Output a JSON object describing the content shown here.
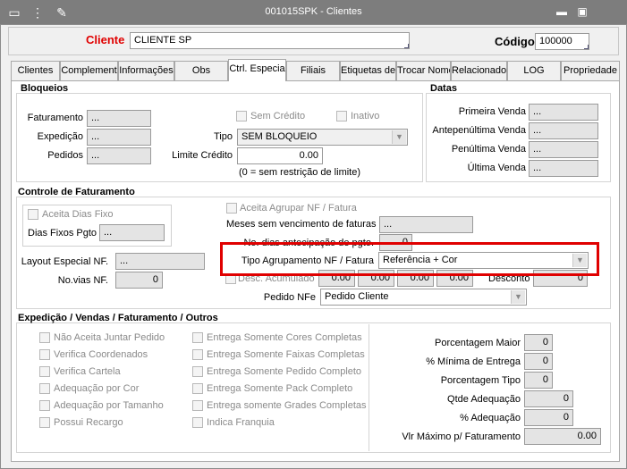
{
  "window": {
    "title": "001015SPK - Clientes"
  },
  "icons": {
    "menu": "page-icon",
    "toolbar": "traffic-light-icon",
    "settings": "wrench-icon",
    "minimize": "minimize-icon",
    "maximize": "maximize-icon"
  },
  "header": {
    "cliente_label": "Cliente",
    "cliente_value": "CLIENTE SP",
    "codigo_label": "Código",
    "codigo_value": "100000"
  },
  "tabs": [
    "Clientes",
    "Complement",
    "Informações",
    "Obs",
    "Ctrl. Especia",
    "Filiais",
    "Etiquetas de",
    "Trocar Nome",
    "Relacionado",
    "LOG",
    "Propriedade"
  ],
  "active_tab_index": 4,
  "bloqueios": {
    "title": "Bloqueios",
    "faturamento_label": "Faturamento",
    "faturamento_value": "...",
    "expedicao_label": "Expedição",
    "expedicao_value": "...",
    "pedidos_label": "Pedidos",
    "pedidos_value": "...",
    "sem_credito_label": "Sem Crédito",
    "inativo_label": "Inativo",
    "tipo_label": "Tipo",
    "tipo_value": "SEM BLOQUEIO",
    "limite_label": "Limite Crédito",
    "limite_value": "0.00",
    "limite_hint": "(0 = sem restrição de limite)"
  },
  "datas": {
    "title": "Datas",
    "primeira_label": "Primeira Venda",
    "primeira_value": "...",
    "antepenultima_label": "Antepenúltima Venda",
    "antepenultima_value": "...",
    "penultima_label": "Penúltima Venda",
    "penultima_value": "...",
    "ultima_label": "Última Venda",
    "ultima_value": "..."
  },
  "controle": {
    "title": "Controle de Faturamento",
    "aceita_dias_label": "Aceita Dias Fixo",
    "dias_fixos_label": "Dias Fixos Pgto",
    "dias_fixos_value": "...",
    "aceita_agrupar_label": "Aceita Agrupar NF / Fatura",
    "meses_label": "Meses sem vencimento de faturas",
    "meses_value": "...",
    "no_dias_label": "No. dias antecipação de pgto.",
    "no_dias_value": "0",
    "tipo_agrup_label": "Tipo Agrupamento NF / Fatura",
    "tipo_agrup_value": "Referência + Cor",
    "layout_label": "Layout Especial NF.",
    "layout_value": "...",
    "no_vias_label": "No.vias NF.",
    "no_vias_value": "0",
    "desc_acum_label": "Desc. Acumulado",
    "desc_values": [
      "0.00",
      "0.00",
      "0.00",
      "0.00"
    ],
    "desconto_label": "Desconto",
    "desconto_value": "0",
    "pedido_nfe_label": "Pedido NFe",
    "pedido_nfe_value": "Pedido Cliente"
  },
  "expedicao": {
    "title": "Expedição / Vendas / Faturamento / Outros",
    "left_checks": [
      "Não Aceita Juntar Pedido",
      "Verifica Coordenados",
      "Verifica Cartela",
      "Adequação por Cor",
      "Adequação por Tamanho",
      "Possui Recargo"
    ],
    "mid_checks": [
      "Entrega Somente Cores Completas",
      "Entrega Somente Faixas Completas",
      "Entrega Somente Pedido Completo",
      "Entrega Somente Pack Completo",
      "Entrega somente Grades Completas",
      "Indica Franquia"
    ],
    "pct_maior_label": "Porcentagem Maior",
    "pct_maior_value": "0",
    "pct_min_label": "% Mínima de Entrega",
    "pct_min_value": "0",
    "pct_tipo_label": "Porcentagem Tipo",
    "pct_tipo_value": "0",
    "qtde_adeq_label": "Qtde Adequação",
    "qtde_adeq_value": "0",
    "pct_adeq_label": "% Adequação",
    "pct_adeq_value": "0",
    "vlr_max_label": "Vlr Máximo p/ Faturamento",
    "vlr_max_value": "0.00"
  },
  "highlight_color": "#e00000"
}
